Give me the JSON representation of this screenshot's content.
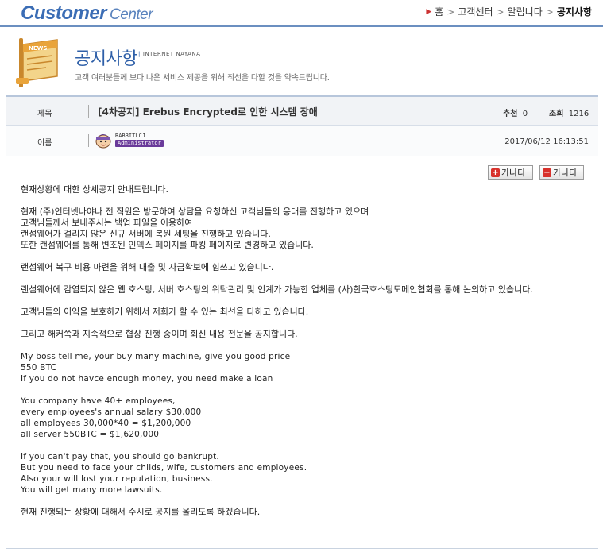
{
  "brand": {
    "word1": "Customer",
    "word2": "Center"
  },
  "breadcrumb": {
    "home": "홈",
    "items": [
      "고객센터",
      "알립니다"
    ],
    "current": "공지사항"
  },
  "header": {
    "title": "공지사항",
    "subtitle": "INTERNET NAYANA",
    "description": "고객 여러분들께 보다 나은 서비스 제공을 위해 최선을 다할 것을 약속드립니다.",
    "icon": "news-scroll-icon",
    "icon_text": "NEWS"
  },
  "post": {
    "subject_label": "제목",
    "subject": "[4차공지] Erebus Encrypted로 인한 시스템 장애",
    "recommend_label": "추천",
    "recommend": "0",
    "views_label": "조회",
    "views": "1216",
    "name_label": "이름",
    "author": "RABBITLCJ",
    "author_role": "Administrator",
    "date": "2017/06/12 16:13:51"
  },
  "buttons": {
    "prev": "가나다",
    "next": "가나다"
  },
  "colors": {
    "accent": "#2e5fa8",
    "button_icon": "#d8312b",
    "role_badge": "#6a3a9a"
  },
  "body": {
    "intro": "현재상황에 대한 상세공지 안내드립니다.",
    "p1": [
      "현재 (주)인터넷나야나 전 직원은 방문하여 상담을 요청하신 고객님들의 응대를 진행하고 있으며",
      "고객님들께서 보내주시는 백업 파일을 이용하여",
      "랜섬웨어가 걸리지 않은 신규 서버에 복원 세팅을 진행하고 있습니다.",
      "또한 랜섬웨어를 통해 변조된 인덱스 페이지를 파킹 페이지로 변경하고 있습니다."
    ],
    "p2": "랜섬웨어 복구 비용 마련을 위해 대출 및 자금확보에 힘쓰고 있습니다.",
    "p3": "랜섬웨어에 감염되지 않은 웹 호스팅, 서버 호스팅의 위탁관리 및 인계가 가능한 업체를 (사)한국호스팅도메인협회를 통해 논의하고 있습니다.",
    "p4": "고객님들의 이익을 보호하기 위해서 저희가 할 수 있는 최선을 다하고 있습니다.",
    "p5": "그리고 해커쪽과 지속적으로 협상 진행 중이며 회신 내용 전문을 공지합니다.",
    "en1": [
      "My boss tell me, your buy many machine, give you good price",
      "550 BTC",
      "If you do not havce enough money, you need make a loan"
    ],
    "en2": [
      "You company have 40+ employees,",
      "every employees's annual salary $30,000",
      "all employees 30,000*40 = $1,200,000",
      "all server 550BTC = $1,620,000"
    ],
    "en3": [
      "If you can't pay that, you should go bankrupt.",
      "But you need to face your childs, wife, customers and employees.",
      "Also your will lost your reputation, business.",
      "You will get many more lawsuits."
    ],
    "closing": "현재 진행되는 상황에 대해서 수시로 공지를 올리도록 하겠습니다."
  }
}
